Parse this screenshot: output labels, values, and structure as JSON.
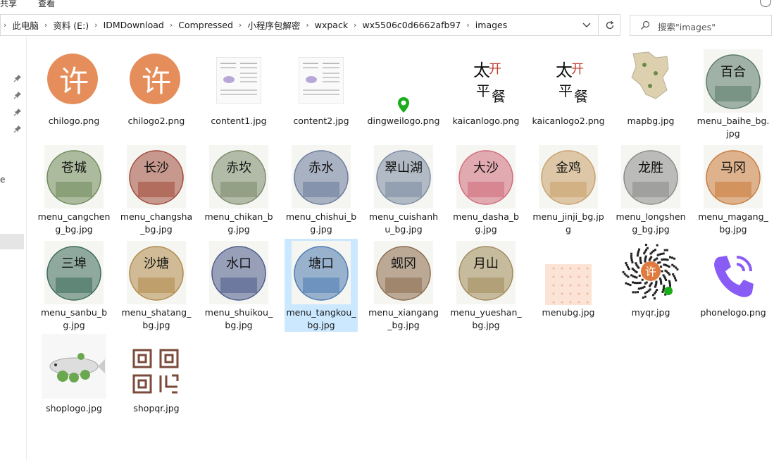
{
  "ribbon": {
    "share": "共享",
    "view": "查看"
  },
  "address": {
    "segments": [
      "此电脑",
      "资料 (E:)",
      "IDMDownload",
      "Compressed",
      "小程序包解密",
      "wxpack",
      "wx5506c0d6662afb97",
      "images"
    ]
  },
  "search": {
    "placeholder": "搜索\"images\""
  },
  "nav": {
    "letter": "e"
  },
  "files": [
    {
      "name": "chilogo.png",
      "kind": "logo",
      "glyph": "许",
      "color": "#e07a3e"
    },
    {
      "name": "chilogo2.png",
      "kind": "logo",
      "glyph": "许",
      "color": "#e07a3e"
    },
    {
      "name": "content1.jpg",
      "kind": "doc"
    },
    {
      "name": "content2.jpg",
      "kind": "doc"
    },
    {
      "name": "dingweilogo.png",
      "kind": "pin",
      "color": "#1aad19"
    },
    {
      "name": "kaicanlogo.png",
      "kind": "calli",
      "glyph": "太平开餐",
      "color": "#111111"
    },
    {
      "name": "kaicanlogo2.png",
      "kind": "calli",
      "glyph": "太平开餐",
      "color": "#111111"
    },
    {
      "name": "mapbg.jpg",
      "kind": "map",
      "color": "#c8b27a"
    },
    {
      "name": "menu_baihe_bg.jpg",
      "kind": "circle",
      "glyph": "百合",
      "color": "#5a7a6a"
    },
    {
      "name": "menu_cangcheng_bg.jpg",
      "kind": "circle",
      "glyph": "苍城",
      "color": "#6f8a5a"
    },
    {
      "name": "menu_changsha_bg.jpg",
      "kind": "circle",
      "glyph": "长沙",
      "color": "#a04a3a"
    },
    {
      "name": "menu_chikan_bg.jpg",
      "kind": "circle",
      "glyph": "赤坎",
      "color": "#7a8a6a"
    },
    {
      "name": "menu_chishui_bg.jpg",
      "kind": "circle",
      "glyph": "赤水",
      "color": "#6a7a9a"
    },
    {
      "name": "menu_cuishanhu_bg.jpg",
      "kind": "circle",
      "glyph": "翠山湖",
      "color": "#7a8aa0"
    },
    {
      "name": "menu_dasha_bg.jpg",
      "kind": "circle",
      "glyph": "大沙",
      "color": "#d06a7a"
    },
    {
      "name": "menu_jinji_bg.jpg",
      "kind": "circle",
      "glyph": "金鸡",
      "color": "#c8a06a"
    },
    {
      "name": "menu_longsheng_bg.jpg",
      "kind": "circle",
      "glyph": "龙胜",
      "color": "#8a8a8a"
    },
    {
      "name": "menu_magang_bg.jpg",
      "kind": "circle",
      "glyph": "马冈",
      "color": "#c87a3a"
    },
    {
      "name": "menu_sanbu_bg.jpg",
      "kind": "circle",
      "glyph": "三埠",
      "color": "#3a6a5a"
    },
    {
      "name": "menu_shatang_bg.jpg",
      "kind": "circle",
      "glyph": "沙塘",
      "color": "#b08a4a"
    },
    {
      "name": "menu_shuikou_bg.jpg",
      "kind": "circle",
      "glyph": "水口",
      "color": "#4a5a8a"
    },
    {
      "name": "menu_tangkou_bg.jpg",
      "kind": "circle",
      "glyph": "塘口",
      "color": "#4a7ab0"
    },
    {
      "name": "menu_xiangang_bg.jpg",
      "kind": "circle",
      "glyph": "蚬冈",
      "color": "#8a6a4a"
    },
    {
      "name": "menu_yueshan_bg.jpg",
      "kind": "circle",
      "glyph": "月山",
      "color": "#a08a5a"
    },
    {
      "name": "menubg.jpg",
      "kind": "dots",
      "color": "#fbe3d6"
    },
    {
      "name": "myqr.jpg",
      "kind": "qr",
      "glyph": "许",
      "color": "#e07a3e"
    },
    {
      "name": "phonelogo.png",
      "kind": "phone",
      "color": "#8a5cf6"
    },
    {
      "name": "shoplogo.jpg",
      "kind": "fish",
      "color": "#6aa84f"
    },
    {
      "name": "shopqr.jpg",
      "kind": "shopqr",
      "color": "#7a4a3a"
    }
  ],
  "selected_file": "menu_tangkou_bg.jpg"
}
